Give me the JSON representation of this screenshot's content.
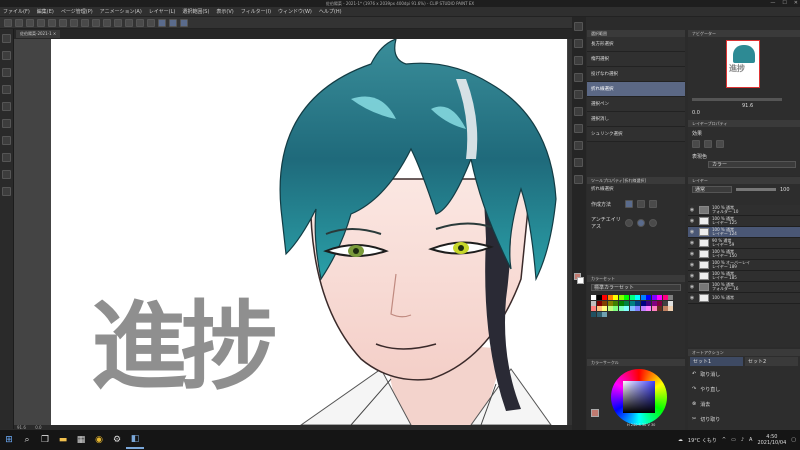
{
  "window": {
    "title": "佐伯陽菜 - 2021-1* (1976 x 2039px 400dpi 91.6%) - CLIP STUDIO PAINT EX",
    "min": "—",
    "max": "☐",
    "close": "✕"
  },
  "menu": [
    "ファイル(F)",
    "編集(E)",
    "ページ管理(P)",
    "アニメーション(A)",
    "レイヤー(L)",
    "選択範囲(S)",
    "表示(V)",
    "フィルター(I)",
    "ウィンドウ(W)",
    "ヘルプ(H)"
  ],
  "doc_tab": "佐伯陽菜-2021-1 ×",
  "canvas": {
    "overlay_text": "進捗",
    "zoom": "91.6",
    "status_coords": "0.0"
  },
  "sub_tool": {
    "header": "選択範囲",
    "items": [
      "長方形選択",
      "楕円選択",
      "投げなわ選択",
      "折れ線選択",
      "選択ペン",
      "選択消し",
      "シュリンク選択"
    ],
    "selected_index": 3
  },
  "tool_property": {
    "header": "ツールプロパティ[折れ線選択]",
    "title": "折れ線選択",
    "rows": [
      {
        "label": "作成方法"
      },
      {
        "label": "アンチエイリアス"
      }
    ]
  },
  "color_set": {
    "header": "カラーセット",
    "select": "標準カラーセット",
    "colors": [
      "#ffffff",
      "#000000",
      "#ff0000",
      "#ff8000",
      "#ffff00",
      "#80ff00",
      "#00ff00",
      "#00ff80",
      "#00ffff",
      "#0080ff",
      "#0000ff",
      "#8000ff",
      "#ff00ff",
      "#ff0080",
      "#808080",
      "#c0c0c0",
      "#800000",
      "#804000",
      "#808000",
      "#408000",
      "#008000",
      "#008040",
      "#008080",
      "#004080",
      "#000080",
      "#400080",
      "#800080",
      "#800040",
      "#404040",
      "#e0e0e0",
      "#ff8080",
      "#ffc080",
      "#ffff80",
      "#c0ff80",
      "#80ff80",
      "#80ffc0",
      "#80ffff",
      "#80c0ff",
      "#8080ff",
      "#c080ff",
      "#ff80ff",
      "#ff80c0",
      "#603020",
      "#c08060",
      "#f0d0b0",
      "#205060",
      "#306070",
      "#70a0b0"
    ]
  },
  "color_circle": {
    "header": "カラーサークル",
    "hsv": "H 240 S 30 V 30"
  },
  "navigator": {
    "header": "ナビゲーター",
    "zoom": "91.6",
    "angle": "0.0"
  },
  "layer_property": {
    "header": "レイヤープロパティ",
    "effect": "効果",
    "color_label": "表現色",
    "color_value": "カラー"
  },
  "layers": {
    "header": "レイヤー",
    "blend": "通常",
    "opacity": "100",
    "rows": [
      {
        "line1": "100 % 通常",
        "line2": "フォルダー 10",
        "folder": true
      },
      {
        "line1": "100 % 通常",
        "line2": "レイヤー 125",
        "folder": false
      },
      {
        "line1": "100 % 通常",
        "line2": "レイヤー 124",
        "folder": false,
        "selected": true
      },
      {
        "line1": "90 % 通常",
        "line2": "レイヤー 59",
        "folder": false
      },
      {
        "line1": "100 % 通常",
        "line2": "レイヤー 150",
        "folder": false
      },
      {
        "line1": "100 % オーバーレイ",
        "line2": "レイヤー 189",
        "folder": false
      },
      {
        "line1": "100 % 通常",
        "line2": "レイヤー 185",
        "folder": false
      },
      {
        "line1": "100 % 通常",
        "line2": "フォルダー 16",
        "folder": true
      },
      {
        "line1": "100 % 通常",
        "line2": "",
        "folder": false
      }
    ]
  },
  "auto_action": {
    "header": "オートアクション",
    "tabs": [
      "セット1",
      "セット2"
    ],
    "items": [
      "取り消し",
      "やり直し",
      "消去",
      "切り取り"
    ]
  },
  "taskbar": {
    "weather": "19°C くもり",
    "ime": "A",
    "time": "4:50",
    "date": "2021/10/04"
  },
  "accent": "#5b6885"
}
